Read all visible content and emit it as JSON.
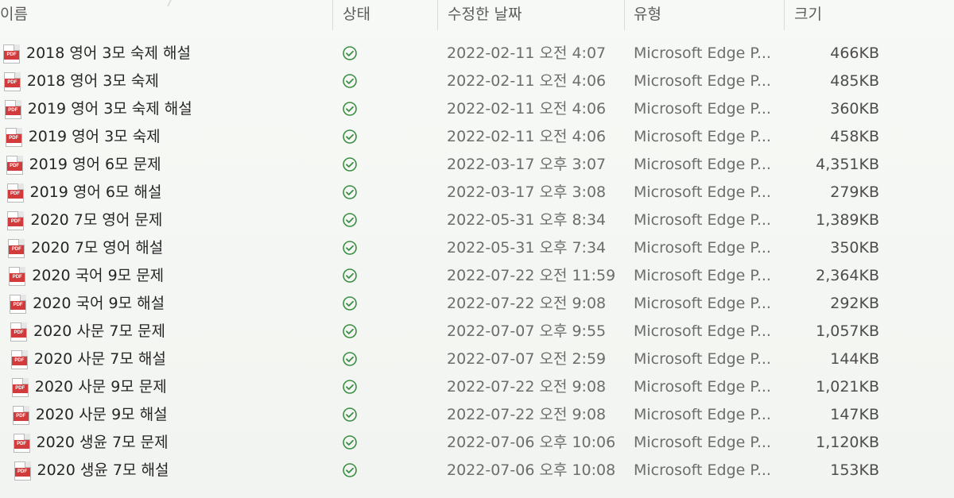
{
  "columns": {
    "name": "이름",
    "status": "상태",
    "modified": "수정한 날짜",
    "type": "유형",
    "size": "크기"
  },
  "icons": {
    "file": "pdf-file-icon",
    "status": "check-circle-icon"
  },
  "colors": {
    "pdf_red": "#d23b3b",
    "status_green": "#3b8e43"
  },
  "rows": [
    {
      "name": "2018 영어 3모 숙제 해설",
      "modified": "2022-02-11 오전 4:07",
      "type": "Microsoft Edge P...",
      "size": "466KB"
    },
    {
      "name": "2018 영어 3모 숙제",
      "modified": "2022-02-11 오전 4:06",
      "type": "Microsoft Edge P...",
      "size": "485KB"
    },
    {
      "name": "2019 영어 3모 숙제 해설",
      "modified": "2022-02-11 오전 4:06",
      "type": "Microsoft Edge P...",
      "size": "360KB"
    },
    {
      "name": "2019 영어 3모 숙제",
      "modified": "2022-02-11 오전 4:06",
      "type": "Microsoft Edge P...",
      "size": "458KB"
    },
    {
      "name": "2019 영어 6모 문제",
      "modified": "2022-03-17 오후 3:07",
      "type": "Microsoft Edge P...",
      "size": "4,351KB"
    },
    {
      "name": "2019 영어 6모 해설",
      "modified": "2022-03-17 오후 3:08",
      "type": "Microsoft Edge P...",
      "size": "279KB"
    },
    {
      "name": "2020 7모 영어 문제",
      "modified": "2022-05-31 오후 8:34",
      "type": "Microsoft Edge P...",
      "size": "1,389KB"
    },
    {
      "name": "2020 7모 영어 해설",
      "modified": "2022-05-31 오후 7:34",
      "type": "Microsoft Edge P...",
      "size": "350KB"
    },
    {
      "name": "2020 국어 9모 문제",
      "modified": "2022-07-22 오전 11:59",
      "type": "Microsoft Edge P...",
      "size": "2,364KB"
    },
    {
      "name": "2020 국어 9모 해설",
      "modified": "2022-07-22 오전 9:08",
      "type": "Microsoft Edge P...",
      "size": "292KB"
    },
    {
      "name": "2020 사문 7모 문제",
      "modified": "2022-07-07 오후 9:55",
      "type": "Microsoft Edge P...",
      "size": "1,057KB"
    },
    {
      "name": "2020 사문 7모 해설",
      "modified": "2022-07-07 오전 2:59",
      "type": "Microsoft Edge P...",
      "size": "144KB"
    },
    {
      "name": "2020 사문 9모 문제",
      "modified": "2022-07-22 오전 9:08",
      "type": "Microsoft Edge P...",
      "size": "1,021KB"
    },
    {
      "name": "2020 사문 9모 해설",
      "modified": "2022-07-22 오전 9:08",
      "type": "Microsoft Edge P...",
      "size": "147KB"
    },
    {
      "name": "2020 생윤 7모 문제",
      "modified": "2022-07-06 오후 10:06",
      "type": "Microsoft Edge P...",
      "size": "1,120KB"
    },
    {
      "name": "2020 생윤 7모 해설",
      "modified": "2022-07-06 오후 10:08",
      "type": "Microsoft Edge P...",
      "size": "153KB"
    }
  ]
}
